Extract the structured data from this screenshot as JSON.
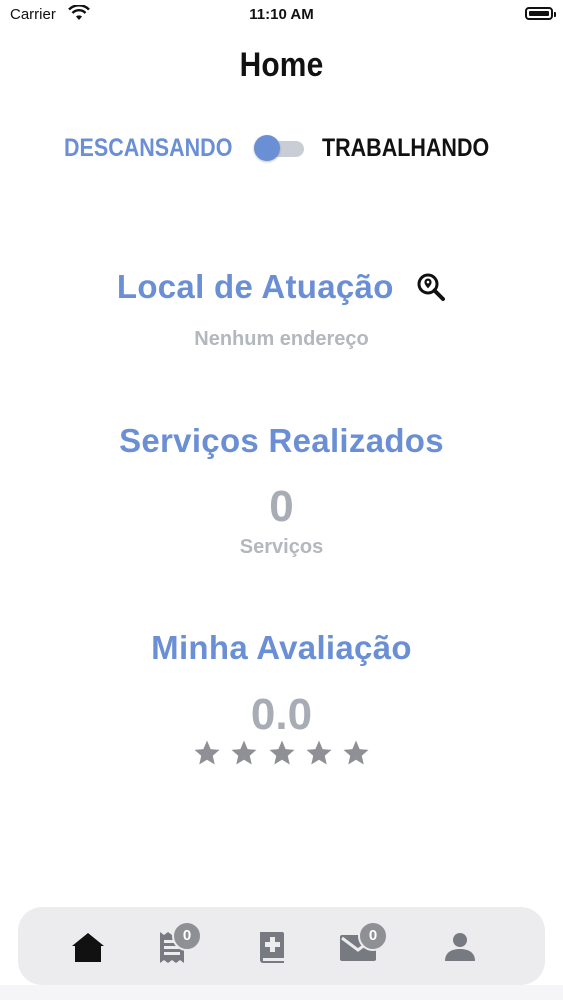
{
  "status_bar": {
    "carrier": "Carrier",
    "time": "11:10 AM"
  },
  "header": {
    "title": "Home"
  },
  "work_toggle": {
    "off_label": "DESCANSANDO",
    "on_label": "TRABALHANDO",
    "is_on": false
  },
  "location": {
    "title": "Local de Atuação",
    "value": "Nenhum endereço",
    "icon": "location-search-icon"
  },
  "services": {
    "title": "Serviços Realizados",
    "count": "0",
    "unit": "Serviços"
  },
  "rating": {
    "title": "Minha Avaliação",
    "score": "0.0",
    "stars_total": 5,
    "stars_filled": 0
  },
  "tabbar": {
    "items": [
      {
        "name": "home",
        "icon": "home-icon",
        "active": true
      },
      {
        "name": "receipts",
        "icon": "receipt-icon",
        "badge": "0"
      },
      {
        "name": "medical-book",
        "icon": "medical-book-icon"
      },
      {
        "name": "messages",
        "icon": "mail-icon",
        "badge": "0"
      },
      {
        "name": "profile",
        "icon": "person-icon"
      }
    ]
  },
  "colors": {
    "accent": "#6b8fd4",
    "muted": "#a8acb4",
    "star": "#8e9096"
  }
}
